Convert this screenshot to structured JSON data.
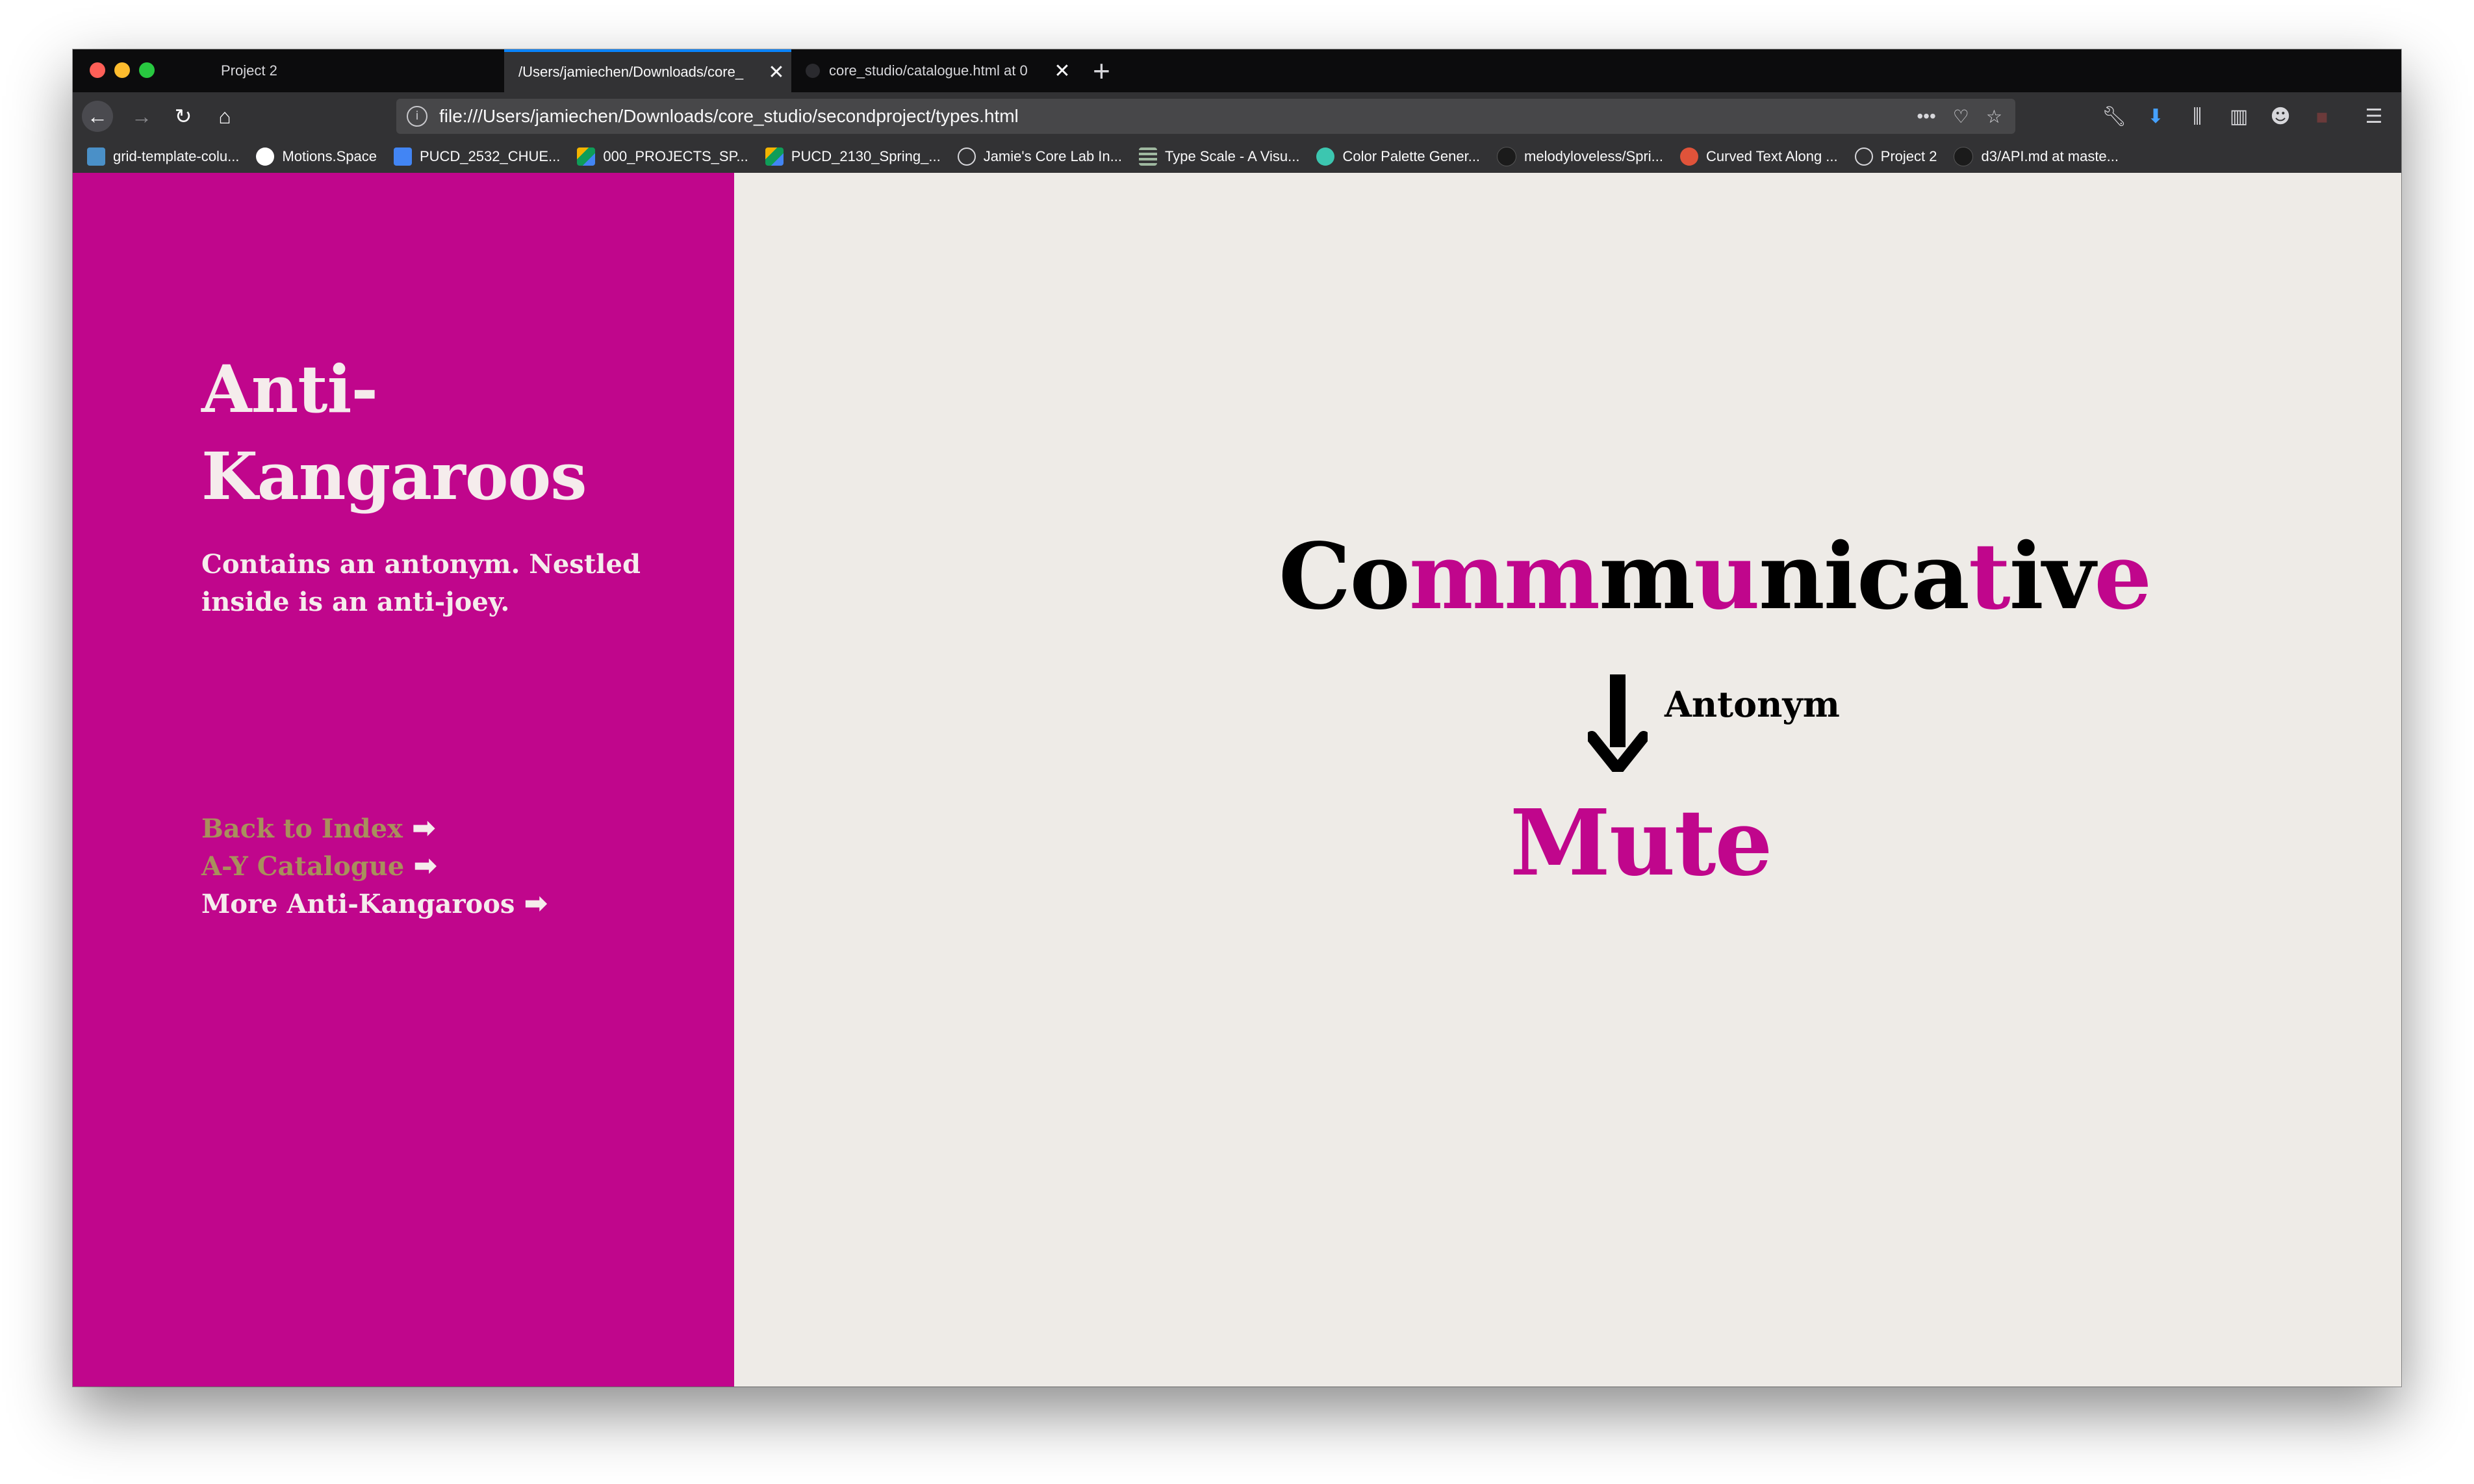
{
  "browser": {
    "tabs": [
      {
        "label": "Project 2",
        "active": false
      },
      {
        "label": "/Users/jamiechen/Downloads/core_",
        "active": true
      },
      {
        "label": "core_studio/catalogue.html at 0",
        "active": false
      }
    ],
    "new_tab_label": "+",
    "url": "file:///Users/jamiechen/Downloads/core_studio/secondproject/types.html",
    "bookmarks": [
      {
        "label": "grid-template-colu...",
        "icon": "bookmark-favicon",
        "color": "#4a90c8"
      },
      {
        "label": "Motions.Space",
        "icon": "circle-favicon",
        "color": "#ffffff"
      },
      {
        "label": "PUCD_2532_CHUE...",
        "icon": "doc-favicon",
        "color": "#4285f4"
      },
      {
        "label": "000_PROJECTS_SP...",
        "icon": "drive-favicon",
        "color": "#f4b400"
      },
      {
        "label": "PUCD_2130_Spring_...",
        "icon": "drive-favicon",
        "color": "#0f9d58"
      },
      {
        "label": "Jamie's Core Lab In...",
        "icon": "globe-favicon",
        "color": "#d7d7db"
      },
      {
        "label": "Type Scale - A Visu...",
        "icon": "lines-favicon",
        "color": "#9fb8a0"
      },
      {
        "label": "Color Palette Gener...",
        "icon": "palette-favicon",
        "color": "#3cc6b0"
      },
      {
        "label": "melodyloveless/Spri...",
        "icon": "github-favicon",
        "color": "#1b1b1b"
      },
      {
        "label": "Curved Text Along ...",
        "icon": "codepen-favicon",
        "color": "#e0533a"
      },
      {
        "label": "Project 2",
        "icon": "globe-favicon",
        "color": "#d7d7db"
      },
      {
        "label": "d3/API.md at maste...",
        "icon": "github-favicon",
        "color": "#1b1b1b"
      }
    ]
  },
  "sidebar": {
    "title_line1": "Anti-",
    "title_line2": "Kangaroos",
    "description": "Contains an antonym. Nestled inside is an anti-joey.",
    "links": [
      {
        "label": "Back to Index",
        "arrow": "➡"
      },
      {
        "label": "A-Y Catalogue",
        "arrow": "➡"
      },
      {
        "label": "More Anti-Kangaroos",
        "arrow": "➡"
      }
    ]
  },
  "main": {
    "word_segments": [
      {
        "text": "Co",
        "highlight": false
      },
      {
        "text": "mm",
        "highlight": true
      },
      {
        "text": "m",
        "highlight": false
      },
      {
        "text": "u",
        "highlight": true
      },
      {
        "text": "nica",
        "highlight": false
      },
      {
        "text": "t",
        "highlight": true
      },
      {
        "text": "iv",
        "highlight": false
      },
      {
        "text": "e",
        "highlight": true
      }
    ],
    "relation_label": "Antonym",
    "result_word": "Mute"
  },
  "colors": {
    "accent_magenta": "#c0068c",
    "page_background": "#eeebe7",
    "visited_link": "#a8905c"
  }
}
